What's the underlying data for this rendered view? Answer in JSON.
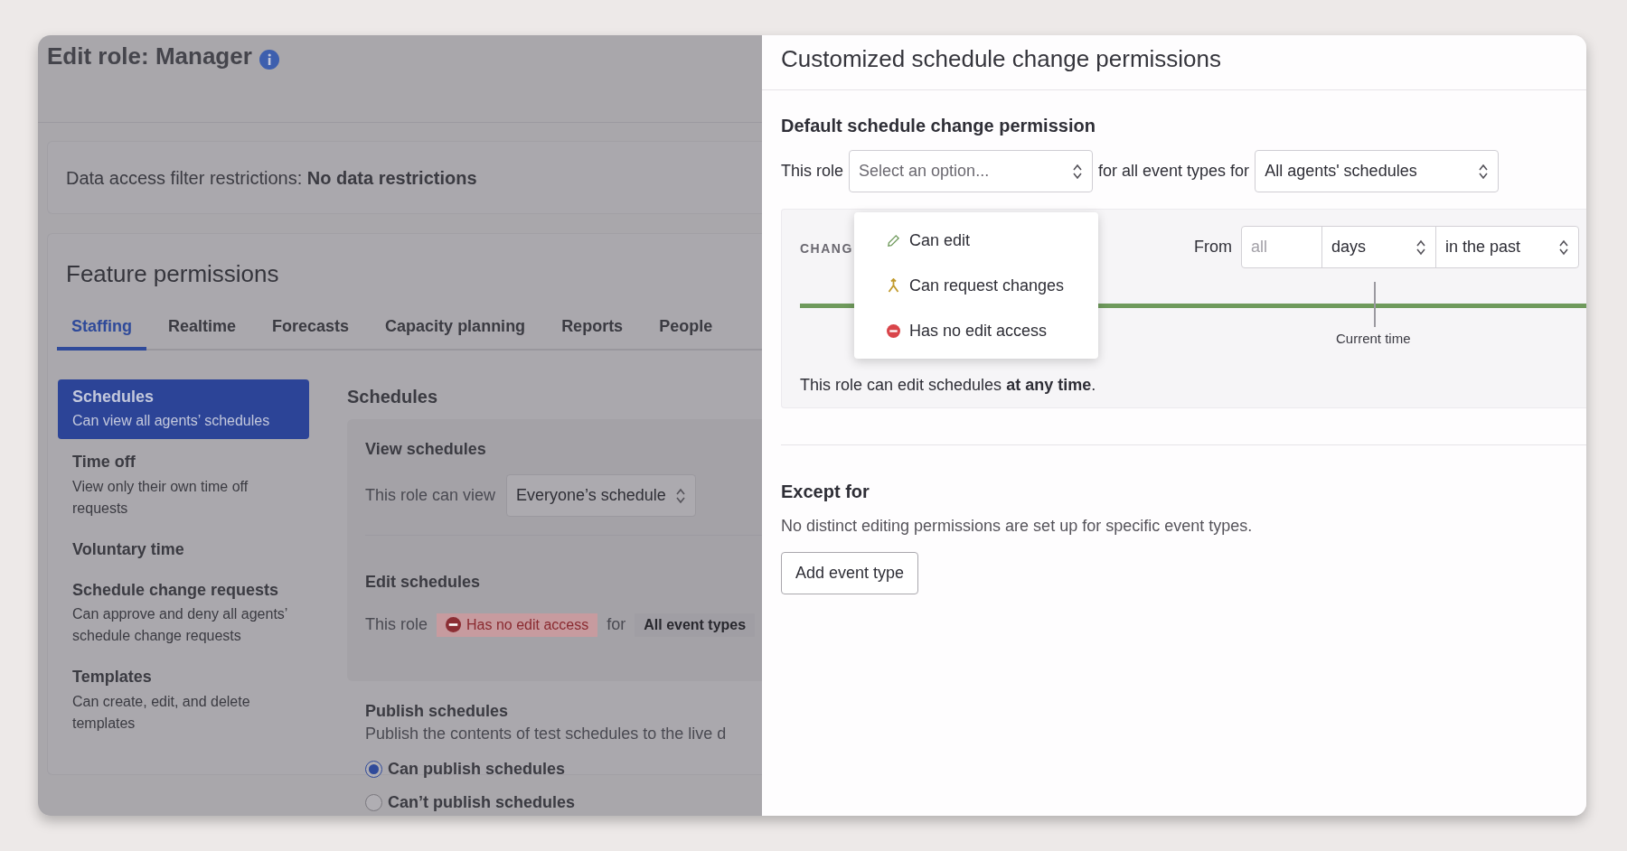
{
  "page": {
    "title": "Edit role: Manager",
    "data_access": {
      "label": "Data access filter restrictions: **No data restrictions**"
    },
    "feature_permissions": {
      "title": "Feature permissions",
      "tabs": [
        {
          "label": "Staffing",
          "selected": true
        },
        {
          "label": "Realtime",
          "selected": false
        },
        {
          "label": "Forecasts",
          "selected": false
        },
        {
          "label": "Capacity planning",
          "selected": false
        },
        {
          "label": "Reports",
          "selected": false
        },
        {
          "label": "People",
          "selected": false
        }
      ],
      "sidebar": [
        {
          "title": "Schedules",
          "description": "Can view all agents’ schedules",
          "selected": true
        },
        {
          "title": "Time off",
          "description": "View only their own time off requests",
          "selected": false
        },
        {
          "title": "Voluntary time",
          "selected": false
        },
        {
          "title": "Schedule change requests",
          "description": "Can approve and deny all agents’ schedule change requests",
          "selected": false
        },
        {
          "title": "Templates",
          "description": "Can create, edit, and delete templates",
          "selected": false
        }
      ],
      "section": {
        "title": "Schedules",
        "view": {
          "title": "View schedules",
          "label": "This role can view",
          "value": "Everyone’s schedule"
        },
        "edit": {
          "title": "Edit schedules",
          "label": "This role",
          "access": "Has no edit access",
          "joiner": "for",
          "event_types": "All event types"
        },
        "publish": {
          "title": "Publish schedules",
          "description": "Publish the contents of test schedules to the live d",
          "options": [
            {
              "label": "Can publish schedules",
              "selected": true
            },
            {
              "label": "Can’t publish schedules",
              "selected": false
            }
          ]
        }
      }
    }
  },
  "drawer": {
    "title": "Customized schedule change permissions",
    "default": {
      "title": "Default schedule change permission",
      "label": "This role",
      "select": {
        "placeholder": "Select an option...",
        "options": [
          {
            "label": "Can edit",
            "kind": "edit"
          },
          {
            "label": "Can request changes",
            "kind": "request"
          },
          {
            "label": "Has no edit access",
            "kind": "none"
          }
        ]
      },
      "joiner": "for all event types for",
      "scope": "All agents' schedules",
      "window": {
        "label": "CHANG",
        "from": "From",
        "amount": {
          "placeholder": "all"
        },
        "unit": "days",
        "direction": "in the past",
        "marker": "Current time",
        "summary": "This role can edit schedules **at any time**."
      }
    },
    "except": {
      "title": "Except for",
      "description": "No distinct editing permissions are set up for specific event types.",
      "button": "Add event type"
    }
  }
}
